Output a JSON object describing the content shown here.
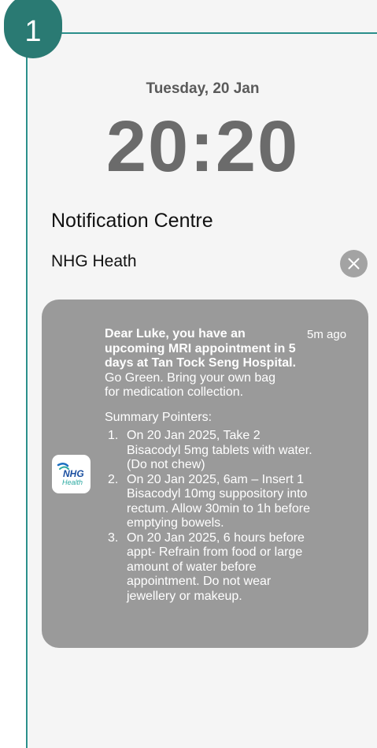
{
  "step": {
    "number": "1"
  },
  "lockscreen": {
    "date": "Tuesday, 20 Jan",
    "time": "20:20"
  },
  "notification_centre": {
    "title": "Notification Centre",
    "group_app_name": "NHG Heath",
    "clear_icon": "close-icon",
    "notification": {
      "app_icon": "nhg-health-logo",
      "app_icon_text": [
        "NHG",
        "Health"
      ],
      "timestamp": "5m ago",
      "headline_lines": [
        "Dear Luke, you have an",
        "upcoming MRI  appointment in 5",
        "days at Tan Tock Seng Hospital."
      ],
      "body_lines": [
        "Go Green. Bring your own bag",
        "for medication collection."
      ],
      "summary_label": "Summary Pointers:",
      "pointers": [
        {
          "num": "1.",
          "lines": [
            "On 20 Jan 2025, Take 2",
            "Bisacodyl 5mg tablets with water.",
            "(Do not chew)"
          ]
        },
        {
          "num": "2.",
          "lines": [
            "On 20 Jan 2025, 6am – Insert 1",
            "Bisacodyl 10mg suppository into",
            "rectum. Allow 30min to 1h before",
            "emptying bowels."
          ]
        },
        {
          "num": "3.",
          "lines": [
            "On 20 Jan 2025, 6 hours before",
            "appt- Refrain from food or large",
            "amount of water before",
            "appointment. Do not wear",
            "jewellery or makeup."
          ]
        }
      ]
    }
  },
  "colors": {
    "accent": "#2a8f8a",
    "badge": "#2a7a73",
    "card": "#9a9a9a",
    "clock": "#6b6b6b"
  }
}
